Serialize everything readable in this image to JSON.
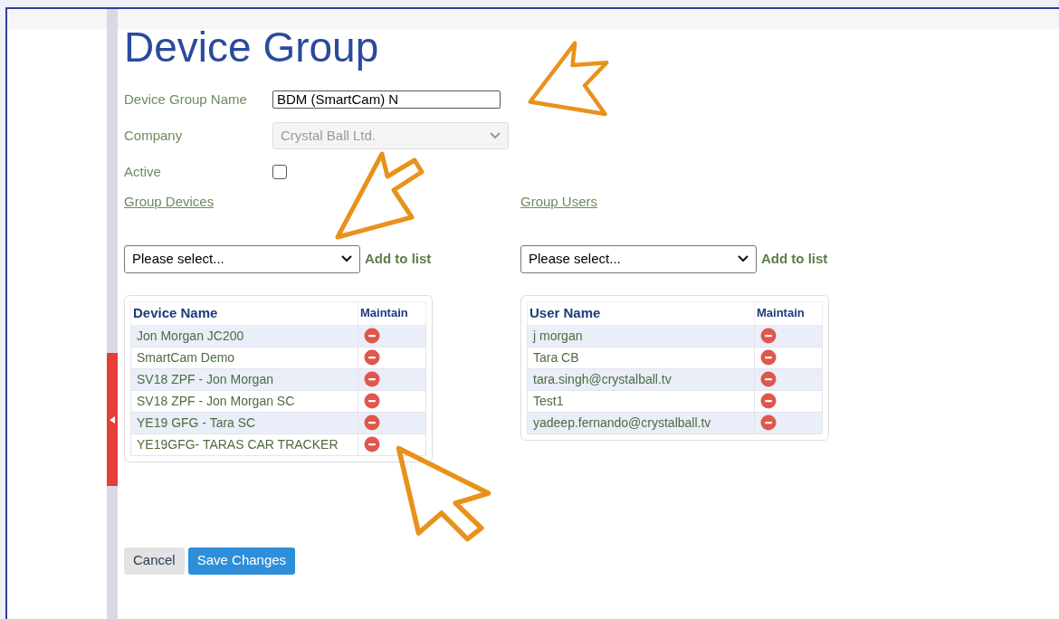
{
  "title": "Device Group",
  "fields": [
    {
      "kind": "text",
      "label": "Device Group Name",
      "value": "BDM (SmartCam) N"
    },
    {
      "kind": "select",
      "label": "Company",
      "value": "Crystal Ball Ltd.",
      "disabled": true
    },
    {
      "kind": "checkbox",
      "label": "Active",
      "checked": false
    }
  ],
  "lists": [
    {
      "link": "Group Devices",
      "select": {
        "placeholder": "Please select..."
      },
      "add": "Add to list",
      "columns": [
        "Device Name",
        "Maintain"
      ],
      "rows": [
        "Jon Morgan JC200",
        "SmartCam Demo",
        "SV18 ZPF - Jon Morgan",
        "SV18 ZPF - Jon Morgan SC",
        "YE19 GFG - Tara SC",
        "YE19GFG- TARAS CAR TRACKER"
      ]
    },
    {
      "link": "Group Users",
      "select": {
        "placeholder": "Please select..."
      },
      "add": "Add to list",
      "columns": [
        "User Name",
        "Maintain"
      ],
      "rows": [
        "j morgan",
        "Tara CB",
        "tara.singh@crystalball.tv",
        "Test1",
        "yadeep.fernando@crystalball.tv"
      ]
    }
  ],
  "buttons": [
    {
      "kind": "secondary",
      "label": "Cancel"
    },
    {
      "kind": "primary",
      "label": "Save Changes"
    }
  ]
}
